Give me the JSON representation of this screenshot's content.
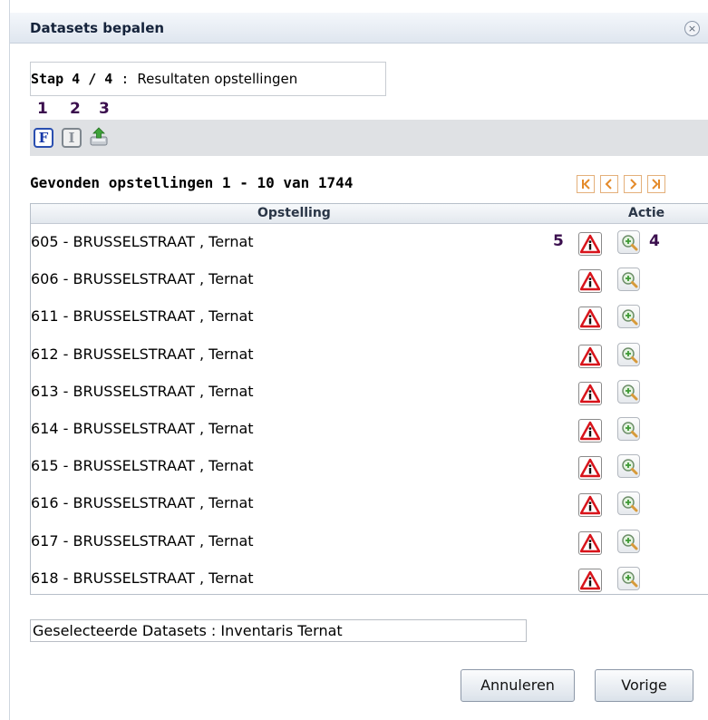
{
  "dialog": {
    "title": "Datasets bepalen",
    "close_symbol": "×"
  },
  "step": {
    "label": "Stap 4 / 4",
    "separator": " : ",
    "description": "Resultaten opstellingen"
  },
  "callouts": [
    "1",
    "2",
    "3",
    "4",
    "5"
  ],
  "toolbar": {
    "f_label": "F",
    "i_label": "I",
    "export_icon": "export-icon"
  },
  "results": {
    "title": "Gevonden opstellingen 1  - 10  van 1744"
  },
  "pager": [
    "first-page-icon",
    "prev-page-icon",
    "next-page-icon",
    "last-page-icon"
  ],
  "table": {
    "columns": [
      "Opstelling",
      "Actie"
    ],
    "rows": [
      "605 - BRUSSELSTRAAT , Ternat",
      "606 - BRUSSELSTRAAT , Ternat",
      "611 - BRUSSELSTRAAT , Ternat",
      "612 - BRUSSELSTRAAT , Ternat",
      "613 - BRUSSELSTRAAT , Ternat",
      "614 - BRUSSELSTRAAT , Ternat",
      "615 - BRUSSELSTRAAT , Ternat",
      "616 - BRUSSELSTRAAT , Ternat",
      "617 - BRUSSELSTRAAT , Ternat",
      "618 - BRUSSELSTRAAT , Ternat"
    ]
  },
  "selected": {
    "text": "Geselecteerde Datasets : Inventaris Ternat"
  },
  "buttons": {
    "cancel": "Annuleren",
    "previous": "Vorige"
  },
  "colors": {
    "accent_orange": "#e48a2a",
    "callout_purple": "#3b0f4e",
    "f_blue": "#1638a8",
    "warning_red": "#d8141b"
  }
}
